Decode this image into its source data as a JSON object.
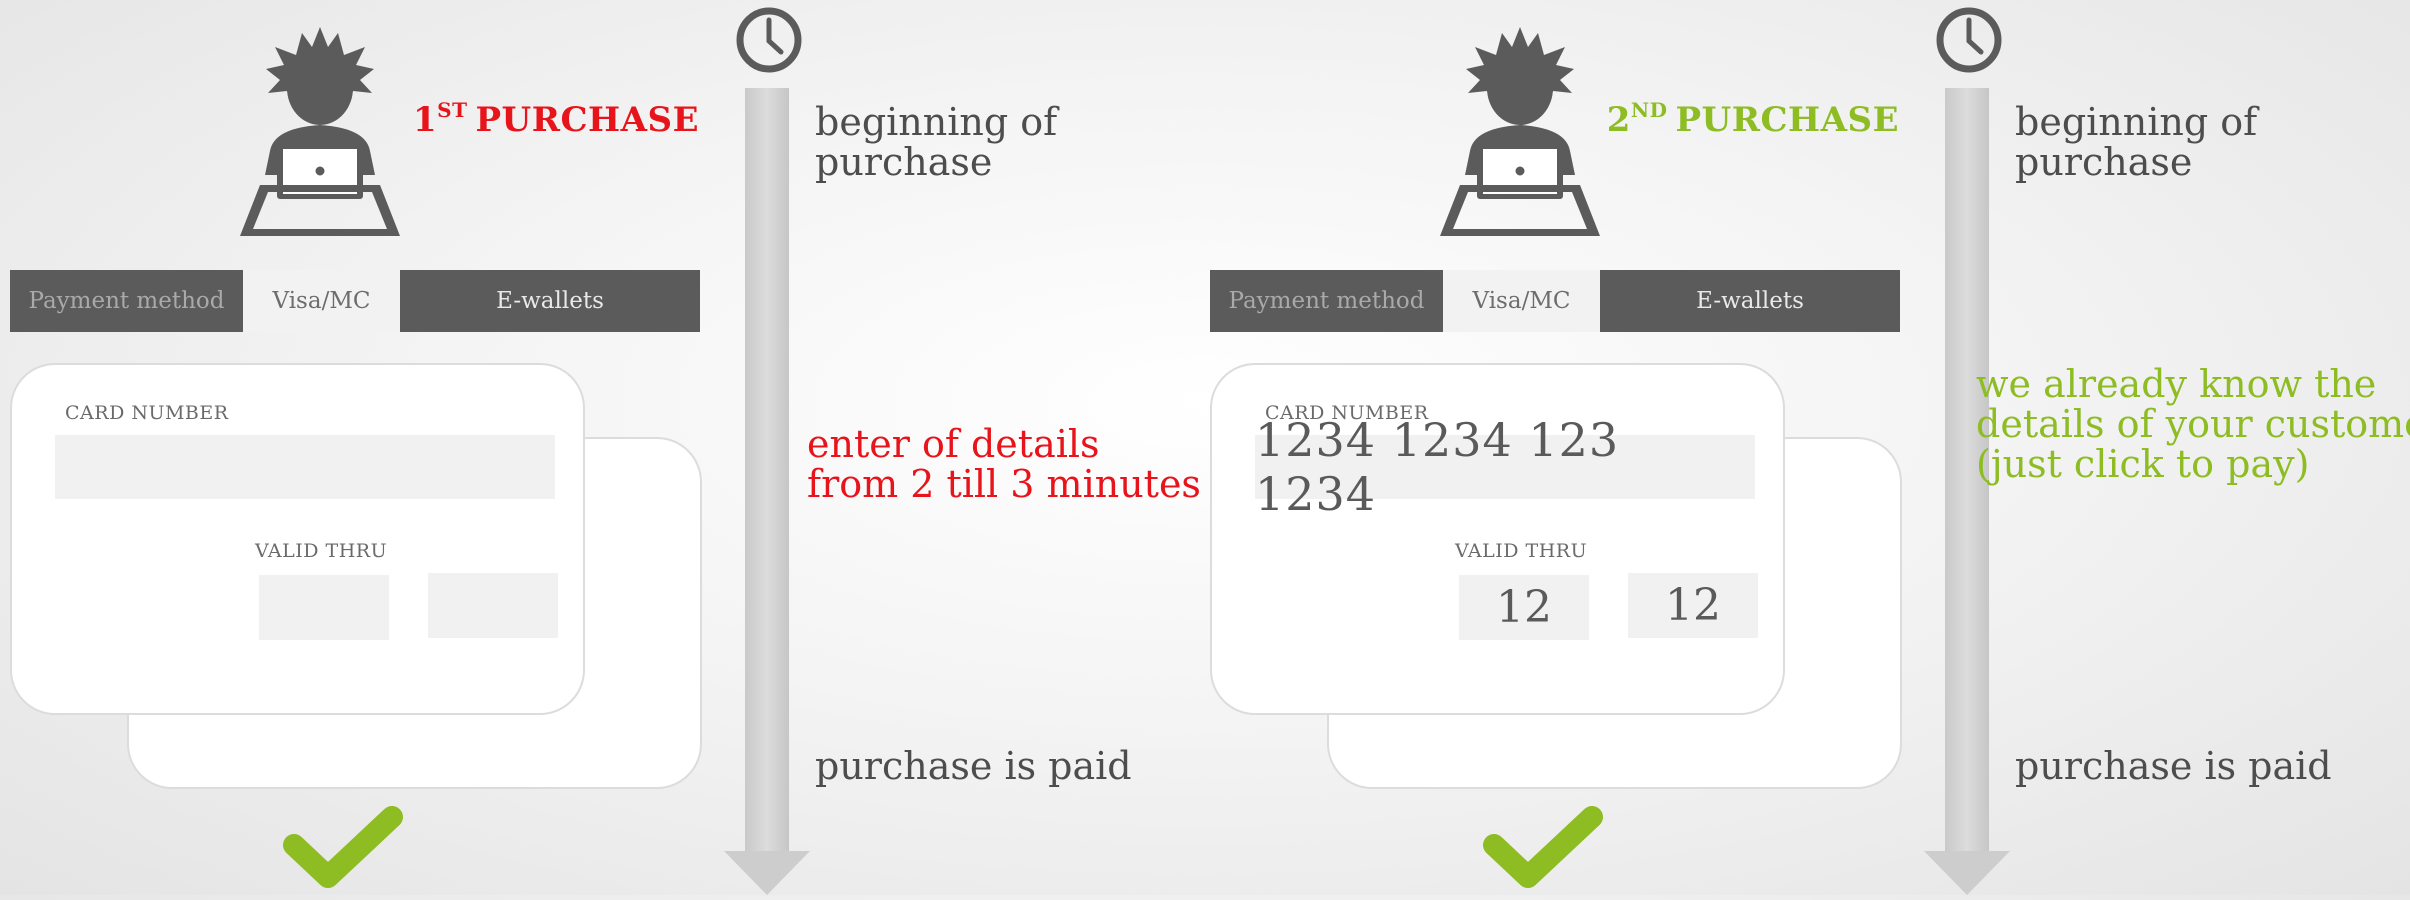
{
  "colors": {
    "first": "#e8141b",
    "second": "#8dbc23",
    "dark": "#5b5b5b",
    "check": "#8dbc23"
  },
  "panels": [
    {
      "title_num": "1",
      "title_sup": "ST",
      "title_text": "PURCHASE",
      "tabs": {
        "payment_method": "Payment method",
        "visa": "Visa/MC",
        "ewallets": "E-wallets"
      },
      "card": {
        "card_number_label": "CARD NUMBER",
        "card_number": "",
        "valid_thru_label": "VALID THRU",
        "month": "",
        "year": ""
      },
      "timeline": {
        "begin": [
          "beginning of",
          "purchase"
        ],
        "middle": [
          "enter of details",
          "from 2 till 3 minutes"
        ],
        "end": "purchase is paid"
      }
    },
    {
      "title_num": "2",
      "title_sup": "ND",
      "title_text": "PURCHASE",
      "tabs": {
        "payment_method": "Payment method",
        "visa": "Visa/MC",
        "ewallets": "E-wallets"
      },
      "card": {
        "card_number_label": "CARD NUMBER",
        "card_number": "1234 1234 123 1234",
        "valid_thru_label": "VALID THRU",
        "month": "12",
        "year": "12"
      },
      "timeline": {
        "begin": [
          "beginning of",
          "purchase"
        ],
        "middle": [
          "we already know the",
          "details of your customer",
          "(just click to pay)"
        ],
        "end": "purchase is paid"
      }
    }
  ]
}
